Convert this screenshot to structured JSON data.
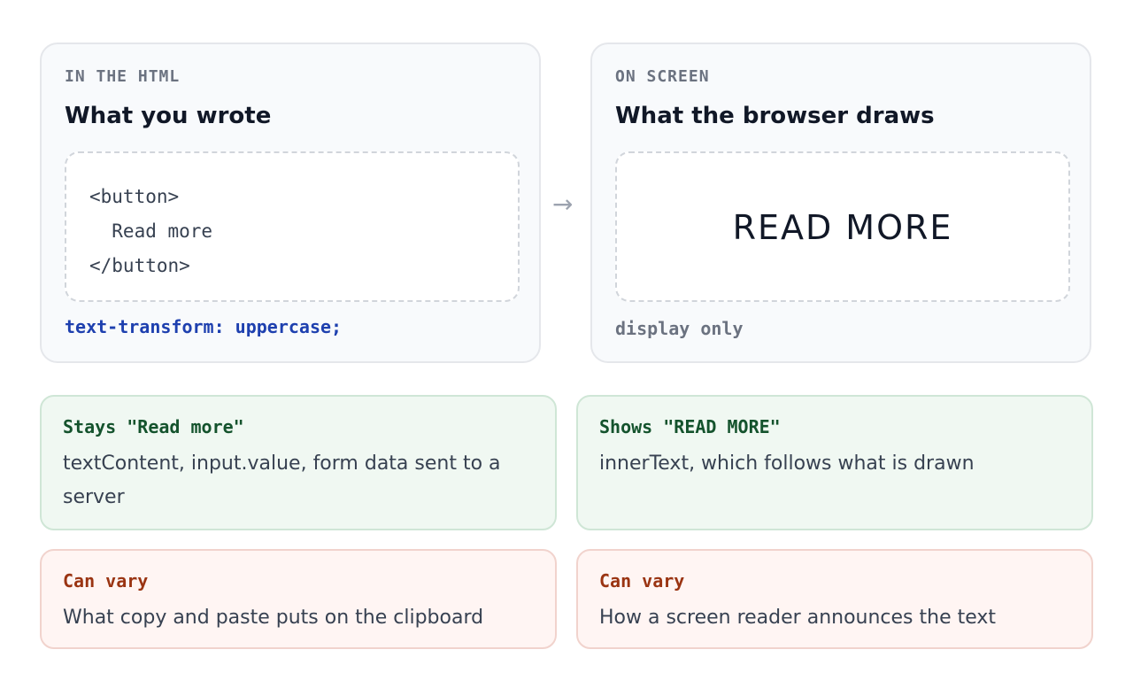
{
  "left_panel": {
    "eyebrow": "IN THE HTML",
    "title": "What you wrote",
    "code": "<button>\n  Read more\n</button>",
    "footer": "text-transform: uppercase;"
  },
  "arrow": "→",
  "right_panel": {
    "eyebrow": "ON SCREEN",
    "title": "What the browser draws",
    "rendered": "READ MORE",
    "footer": "display only"
  },
  "cards": [
    {
      "heading": "Stays \"Read more\"",
      "body": "textContent, input.value, form data sent to a server",
      "tone": "green"
    },
    {
      "heading": "Shows \"READ MORE\"",
      "body": "innerText, which follows what is drawn",
      "tone": "green"
    },
    {
      "heading": "Can vary",
      "body": "What copy and paste puts on the clipboard",
      "tone": "red"
    },
    {
      "heading": "Can vary",
      "body": "How a screen reader announces the text",
      "tone": "red"
    }
  ],
  "colors": {
    "green_bg": "#f0f8f2",
    "red_bg": "#fff5f3",
    "css_accent": "#1e40af"
  }
}
